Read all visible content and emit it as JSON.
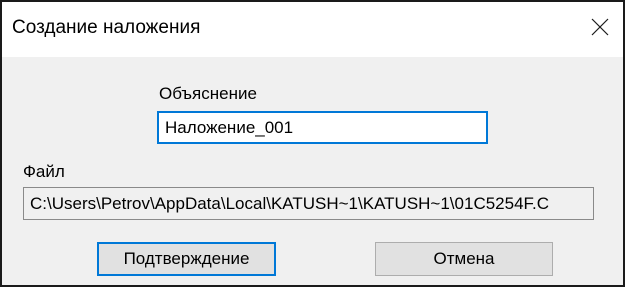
{
  "dialog": {
    "title": "Создание наложения",
    "close_icon": "close-icon"
  },
  "explanation": {
    "label": "Объяснение",
    "value": "Наложение_001"
  },
  "file": {
    "label": "Файл",
    "path": "C:\\Users\\Petrov\\AppData\\Local\\KATUSH~1\\KATUSH~1\\01C5254F.C"
  },
  "buttons": {
    "confirm_label": "Подтверждение",
    "cancel_label": "Отмена"
  },
  "colors": {
    "accent": "#0078d7",
    "dialog_background": "#f0f0f0",
    "titlebar_background": "#ffffff",
    "button_face": "#e1e1e1"
  }
}
